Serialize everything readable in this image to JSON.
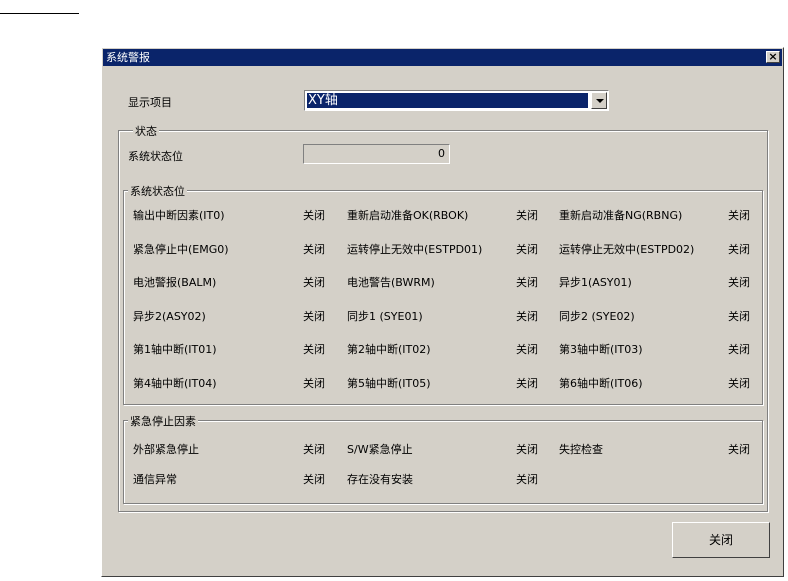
{
  "window": {
    "title": "系统警报",
    "close_glyph": "×"
  },
  "display": {
    "label": "显示项目",
    "selected": "XY轴"
  },
  "status_group": {
    "title": "状态",
    "status_label": "系统状态位",
    "status_value": "0"
  },
  "status_bits": {
    "title": "系统状态位",
    "rows": [
      [
        {
          "label": "输出中断因素(IT0)",
          "value": "关闭"
        },
        {
          "label": "重新启动准备OK(RBOK)",
          "value": "关闭"
        },
        {
          "label": "重新启动准备NG(RBNG)",
          "value": "关闭"
        }
      ],
      [
        {
          "label": "紧急停止中(EMG0)",
          "value": "关闭"
        },
        {
          "label": "运转停止无效中(ESTPD01)",
          "value": "关闭"
        },
        {
          "label": "运转停止无效中(ESTPD02)",
          "value": "关闭"
        }
      ],
      [
        {
          "label": "电池警报(BALM)",
          "value": "关闭"
        },
        {
          "label": "电池警告(BWRM)",
          "value": "关闭"
        },
        {
          "label": "异步1(ASY01)",
          "value": "关闭"
        }
      ],
      [
        {
          "label": "异步2(ASY02)",
          "value": "关闭"
        },
        {
          "label": "同步1 (SYE01)",
          "value": "关闭"
        },
        {
          "label": "同步2 (SYE02)",
          "value": "关闭"
        }
      ],
      [
        {
          "label": "第1轴中断(IT01)",
          "value": "关闭"
        },
        {
          "label": "第2轴中断(IT02)",
          "value": "关闭"
        },
        {
          "label": "第3轴中断(IT03)",
          "value": "关闭"
        }
      ],
      [
        {
          "label": "第4轴中断(IT04)",
          "value": "关闭"
        },
        {
          "label": "第5轴中断(IT05)",
          "value": "关闭"
        },
        {
          "label": "第6轴中断(IT06)",
          "value": "关闭"
        }
      ]
    ]
  },
  "emergency": {
    "title": "紧急停止因素",
    "rows": [
      [
        {
          "label": "外部紧急停止",
          "value": "关闭"
        },
        {
          "label": "S/W紧急停止",
          "value": "关闭"
        },
        {
          "label": "失控检查",
          "value": "关闭"
        }
      ],
      [
        {
          "label": "通信异常",
          "value": "关闭"
        },
        {
          "label": "存在没有安装",
          "value": "关闭"
        }
      ]
    ]
  },
  "footer": {
    "close_label": "关闭"
  }
}
